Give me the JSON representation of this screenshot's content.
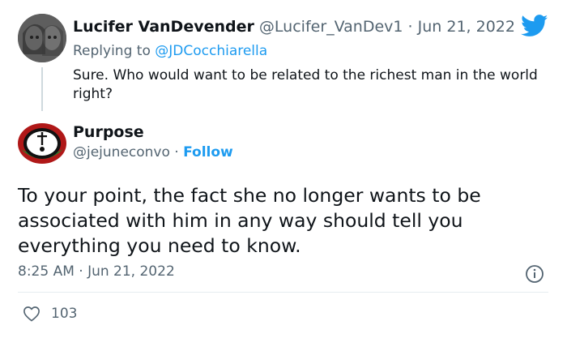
{
  "reply": {
    "author_name": "Lucifer VanDevender",
    "author_handle": "@Lucifer_VanDev1",
    "separator": " · ",
    "date": "Jun 21, 2022",
    "replying_prefix": "Replying to ",
    "replying_handle": "@JDCocchiarella",
    "text": "Sure. Who would want to be related to the richest man in the world right?"
  },
  "tweet": {
    "author_name": "Purpose",
    "author_handle": "@jejuneconvo",
    "separator": " · ",
    "follow_label": "Follow",
    "text": "To your point, the fact she no longer wants to be associated with him in any way should tell you everything you need to know.",
    "timestamp": "8:25 AM · Jun 21, 2022",
    "like_count": "103"
  },
  "icons": {
    "brand": "twitter-bird-icon",
    "info": "info-icon",
    "like": "heart-icon"
  },
  "colors": {
    "link": "#1d9bf0",
    "secondary_text": "#536471",
    "primary_text": "#0f1419"
  }
}
